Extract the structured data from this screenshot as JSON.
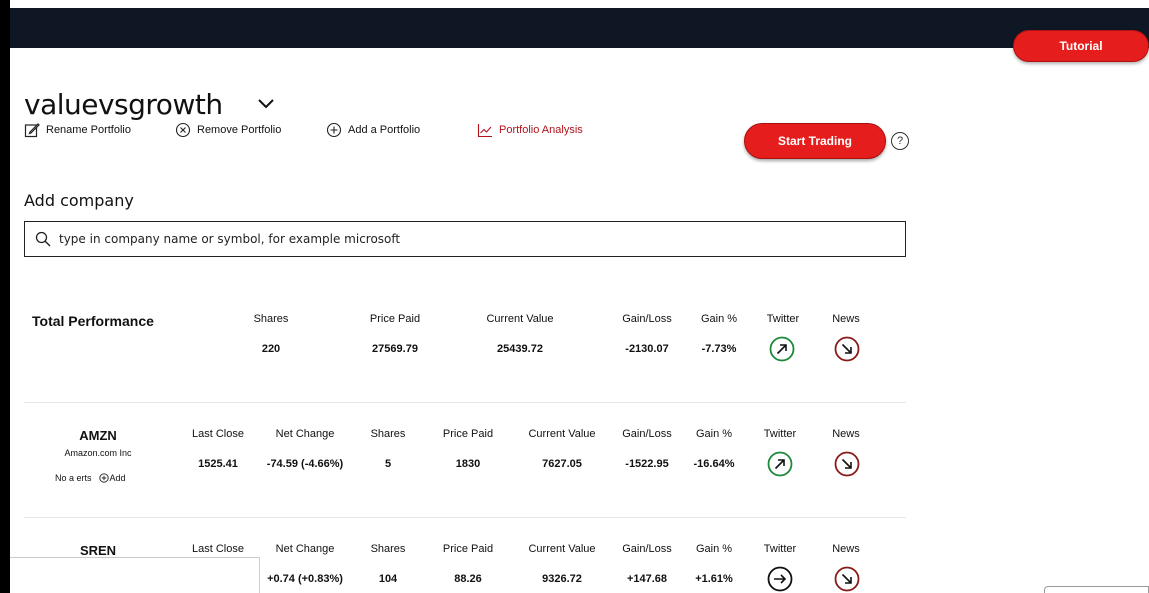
{
  "header": {
    "tutorial_label": "Tutorial"
  },
  "portfolio": {
    "name": "valuevsgrowth",
    "actions": {
      "rename": "Rename Portfolio",
      "remove": "Remove Portfolio",
      "add": "Add a Portfolio",
      "analysis": "Portfolio Analysis"
    },
    "start_trading": "Start Trading",
    "help": "?"
  },
  "add_company": {
    "label": "Add company",
    "placeholder": "type in company name or symbol, for example microsoft"
  },
  "total": {
    "title": "Total Performance",
    "headers": {
      "shares": "Shares",
      "price_paid": "Price Paid",
      "current_value": "Current Value",
      "gain_loss": "Gain/Loss",
      "gain_pct": "Gain %",
      "twitter": "Twitter",
      "news": "News"
    },
    "values": {
      "shares": "220",
      "price_paid": "27569.79",
      "current_value": "25439.72",
      "gain_loss": "-2130.07",
      "gain_pct": "-7.73%"
    },
    "twitter_trend": "up-arrow-circle",
    "news_trend": "down-arrow-circle"
  },
  "holding_headers": {
    "last_close": "Last Close",
    "net_change": "Net Change",
    "shares": "Shares",
    "price_paid": "Price Paid",
    "current_value": "Current Value",
    "gain_loss": "Gain/Loss",
    "gain_pct": "Gain %",
    "twitter": "Twitter",
    "news": "News"
  },
  "holdings": [
    {
      "symbol": "AMZN",
      "name": "Amazon.com Inc",
      "alerts": "No a erts",
      "add": "Add",
      "last_close": "1525.41",
      "net_change": "-74.59 (-4.66%)",
      "shares": "5",
      "price_paid": "1830",
      "current_value": "7627.05",
      "gain_loss": "-1522.95",
      "gain_pct": "-16.64%",
      "twitter_trend": "up-arrow-circle",
      "news_trend": "down-arrow-circle"
    },
    {
      "symbol": "SREN",
      "last_close": "",
      "net_change": "+0.74 (+0.83%)",
      "shares": "104",
      "price_paid": "88.26",
      "current_value": "9326.72",
      "gain_loss": "+147.68",
      "gain_pct": "+1.61%",
      "twitter_trend": "right-arrow-circle",
      "news_trend": "down-arrow-circle"
    }
  ],
  "colors": {
    "topbar": "#0f1624",
    "accent_red": "#e51d1d",
    "trend_up": "#1d8a3a",
    "trend_down": "#8b1a1a",
    "analysis_link": "#b3121a"
  }
}
